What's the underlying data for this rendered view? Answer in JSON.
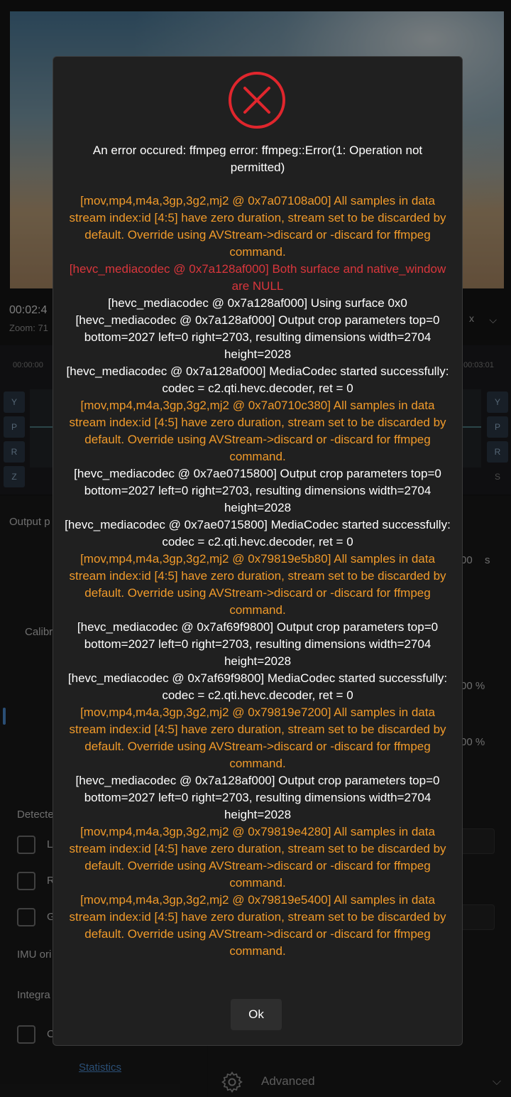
{
  "background": {
    "timecode": "00:02:4",
    "zoom_label": "Zoom: 71",
    "speed_value": "x",
    "timeline_start": "00:00:00",
    "timeline_end": "00:03:01",
    "axis_left": [
      "Y",
      "P",
      "R",
      "Z"
    ],
    "axis_right": [
      "Y",
      "P",
      "R",
      "S"
    ],
    "output_label": "Output p",
    "seconds_unit": "s",
    "seconds_value": "00",
    "calib_label": "Calibr",
    "percent_a": "00 %",
    "percent_b": "00 %",
    "detected_label": "Detecte",
    "check_labels": [
      "L",
      "R",
      "G"
    ],
    "imu_label": "IMU ori",
    "integration_label": "Integra",
    "check_bottom_label": "C",
    "statistics_link": "Statistics",
    "advanced_label": "Advanced"
  },
  "dialog": {
    "icon": "error-x-circle-icon",
    "title": "An error occured: ffmpeg error: ffmpeg::Error(1: Operation not permitted)",
    "ok_label": "Ok",
    "log": [
      {
        "level": "warn",
        "text": "[mov,mp4,m4a,3gp,3g2,mj2 @ 0x7a07108a00] All samples in data stream index:id [4:5] have zero duration, stream set to be discarded by default. Override using AVStream->discard or -discard for ffmpeg command."
      },
      {
        "level": "err",
        "text": "[hevc_mediacodec @ 0x7a128af000] Both surface and native_window are NULL"
      },
      {
        "level": "info",
        "text": "[hevc_mediacodec @ 0x7a128af000] Using surface 0x0"
      },
      {
        "level": "info",
        "text": "[hevc_mediacodec @ 0x7a128af000] Output crop parameters top=0 bottom=2027 left=0 right=2703, resulting dimensions width=2704 height=2028"
      },
      {
        "level": "info",
        "text": "[hevc_mediacodec @ 0x7a128af000] MediaCodec started successfully: codec = c2.qti.hevc.decoder, ret = 0"
      },
      {
        "level": "warn",
        "text": "[mov,mp4,m4a,3gp,3g2,mj2 @ 0x7a0710c380] All samples in data stream index:id [4:5] have zero duration, stream set to be discarded by default. Override using AVStream->discard or -discard for ffmpeg command."
      },
      {
        "level": "info",
        "text": "[hevc_mediacodec @ 0x7ae0715800] Output crop parameters top=0 bottom=2027 left=0 right=2703, resulting dimensions width=2704 height=2028"
      },
      {
        "level": "info",
        "text": "[hevc_mediacodec @ 0x7ae0715800] MediaCodec started successfully: codec = c2.qti.hevc.decoder, ret = 0"
      },
      {
        "level": "warn",
        "text": "[mov,mp4,m4a,3gp,3g2,mj2 @ 0x79819e5b80] All samples in data stream index:id [4:5] have zero duration, stream set to be discarded by default. Override using AVStream->discard or -discard for ffmpeg command."
      },
      {
        "level": "info",
        "text": "[hevc_mediacodec @ 0x7af69f9800] Output crop parameters top=0 bottom=2027 left=0 right=2703, resulting dimensions width=2704 height=2028"
      },
      {
        "level": "info",
        "text": "[hevc_mediacodec @ 0x7af69f9800] MediaCodec started successfully: codec = c2.qti.hevc.decoder, ret = 0"
      },
      {
        "level": "warn",
        "text": "[mov,mp4,m4a,3gp,3g2,mj2 @ 0x79819e7200] All samples in data stream index:id [4:5] have zero duration, stream set to be discarded by default. Override using AVStream->discard or -discard for ffmpeg command."
      },
      {
        "level": "info",
        "text": "[hevc_mediacodec @ 0x7a128af000] Output crop parameters top=0 bottom=2027 left=0 right=2703, resulting dimensions width=2704 height=2028"
      },
      {
        "level": "warn",
        "text": "[mov,mp4,m4a,3gp,3g2,mj2 @ 0x79819e4280] All samples in data stream index:id [4:5] have zero duration, stream set to be discarded by default. Override using AVStream->discard or -discard for ffmpeg command."
      },
      {
        "level": "warn",
        "text": "[mov,mp4,m4a,3gp,3g2,mj2 @ 0x79819e5400] All samples in data stream index:id [4:5] have zero duration, stream set to be discarded by default. Override using AVStream->discard or -discard for ffmpeg command."
      }
    ]
  },
  "colors": {
    "warn": "#f09a2a",
    "error": "#d9363c",
    "info": "#ffffff",
    "link": "#4d8fd6"
  }
}
